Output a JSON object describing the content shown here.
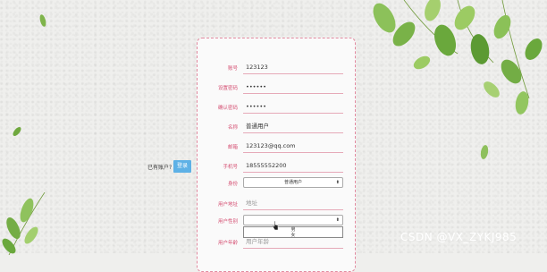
{
  "form": {
    "rows": [
      {
        "label": "账号",
        "value": "123123",
        "placeholder": ""
      },
      {
        "label": "设置密码",
        "value": "••••••",
        "placeholder": ""
      },
      {
        "label": "确认密码",
        "value": "••••••",
        "placeholder": ""
      },
      {
        "label": "名称",
        "value": "普通用户",
        "placeholder": ""
      },
      {
        "label": "邮箱",
        "value": "123123@qq.com",
        "placeholder": ""
      },
      {
        "label": "手机号",
        "value": "18555552200",
        "placeholder": ""
      },
      {
        "label": "身份",
        "select_value": "普通用户"
      },
      {
        "label": "用户地址",
        "value": "",
        "placeholder": "地址"
      },
      {
        "label": "用户性别",
        "select_value": "",
        "dropdown_options": [
          "男",
          "女"
        ]
      },
      {
        "label": "用户年龄",
        "value": "",
        "placeholder": "用户年龄"
      }
    ]
  },
  "side_login": {
    "text": "已有账户?",
    "button_label": "登录"
  },
  "watermark": "CSDN @VX_ZYKJ985",
  "colors": {
    "label": "#d44d71",
    "border": "#e28aa0",
    "button": "#5eb1e6"
  }
}
